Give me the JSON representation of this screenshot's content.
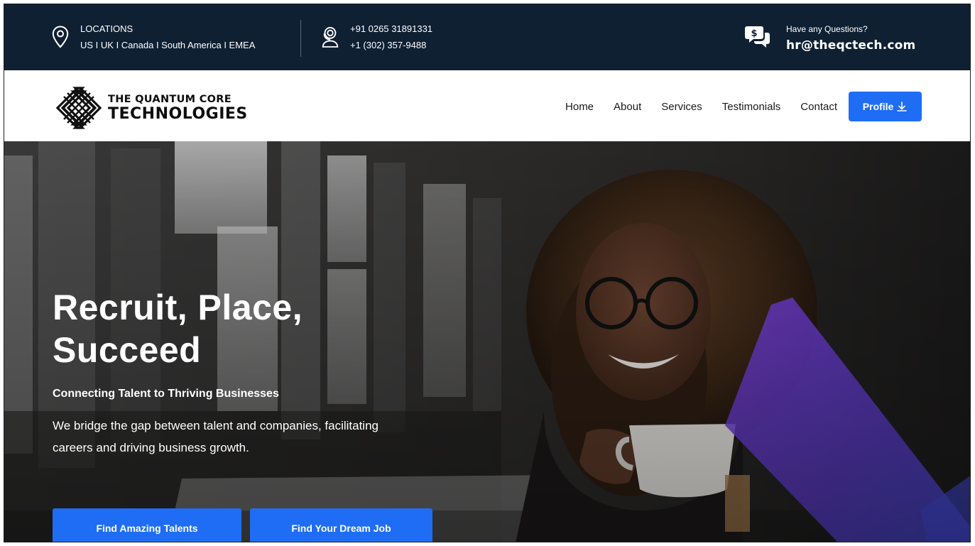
{
  "topbar": {
    "locations": {
      "title": "LOCATIONS",
      "list": "US I UK I Canada I South America I EMEA",
      "icon": "location-pin-icon"
    },
    "phones": {
      "primary": "+91 0265 31891331",
      "secondary": "+1 (302) 357-9488",
      "icon": "headset-icon"
    },
    "contact": {
      "prompt": "Have any Questions?",
      "email": "hr@theqctech.com",
      "icon": "chat-dollar-icon"
    }
  },
  "brand": {
    "line1": "THE QUANTUM CORE",
    "line2": "TECHNOLOGIES"
  },
  "nav": {
    "items": [
      "Home",
      "About",
      "Services",
      "Testimonials",
      "Contact"
    ],
    "profile_label": "Profile",
    "profile_icon": "download-icon"
  },
  "hero": {
    "title": "Recruit, Place, Succeed",
    "subtitle": "Connecting Talent to Thriving Businesses",
    "description": "We bridge the gap between talent and companies, facilitating careers and driving business growth.",
    "primary_button": "Find Amazing Talents",
    "secondary_button": "Find Your Dream Job"
  },
  "colors": {
    "topbar_bg": "#0f2033",
    "accent": "#1f6df5",
    "hero_overlay_purple": "#6a3fd4"
  }
}
